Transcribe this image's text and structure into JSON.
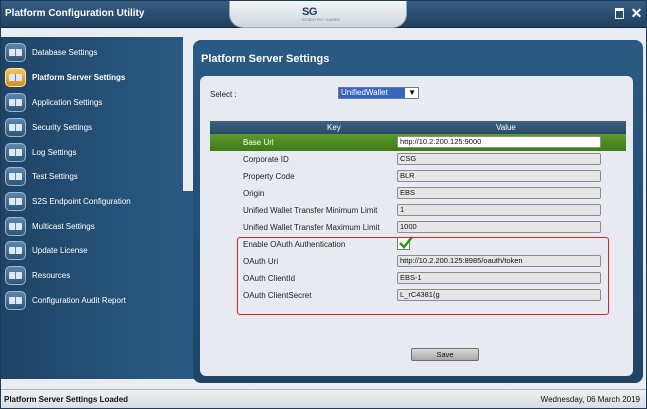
{
  "window": {
    "title": "Platform Configuration Utility"
  },
  "logo": {
    "text": "SG",
    "tagline": "SCIENTIFIC GAMES"
  },
  "sidebar": {
    "items": [
      {
        "label": "Database Settings",
        "active": false
      },
      {
        "label": "Platform Server Settings",
        "active": true
      },
      {
        "label": "Application Settings",
        "active": false
      },
      {
        "label": "Security Settings",
        "active": false
      },
      {
        "label": "Log Settings",
        "active": false
      },
      {
        "label": "Test Settings",
        "active": false
      },
      {
        "label": "S2S Endpoint Configuration",
        "active": false
      },
      {
        "label": "Multicast Settings",
        "active": false
      },
      {
        "label": "Update License",
        "active": false
      },
      {
        "label": "Resources",
        "active": false
      },
      {
        "label": "Configuration Audit Report",
        "active": false
      }
    ]
  },
  "main": {
    "title": "Platform Server Settings",
    "select_label": "Select :",
    "select_value": "UnifiedWallet",
    "grid": {
      "headers": {
        "key": "Key",
        "value": "Value"
      },
      "rows": [
        {
          "key": "Base Url",
          "value": "http://10.2.200.125:9000",
          "selected": true
        },
        {
          "key": "Corporate ID",
          "value": "CSG"
        },
        {
          "key": "Property Code",
          "value": "BLR"
        },
        {
          "key": "Origin",
          "value": "EBS"
        },
        {
          "key": "Unified Wallet Transfer Minimum Limit",
          "value": "1"
        },
        {
          "key": "Unified Wallet Transfer Maximum Limit",
          "value": "1000"
        },
        {
          "key": "Enable OAuth Authentication",
          "value": "",
          "checkbox": true,
          "checked": true
        },
        {
          "key": "OAuth Uri",
          "value": "http://10.2.200.125:8985/oauth/token"
        },
        {
          "key": "OAuth ClientId",
          "value": "EBS-1"
        },
        {
          "key": "OAuth ClientSecret",
          "value": "L_rC4381(g"
        }
      ]
    },
    "save_label": "Save"
  },
  "status": {
    "message": "Platform Server Settings Loaded",
    "date": "Wednesday, 06 March 2019"
  },
  "colors": {
    "title_bar": "#20405f",
    "sidebar": "#2a5a84",
    "selected_row": "#4f8c22",
    "highlight_border": "#e02020",
    "dropdown_selection": "#3665c2"
  }
}
